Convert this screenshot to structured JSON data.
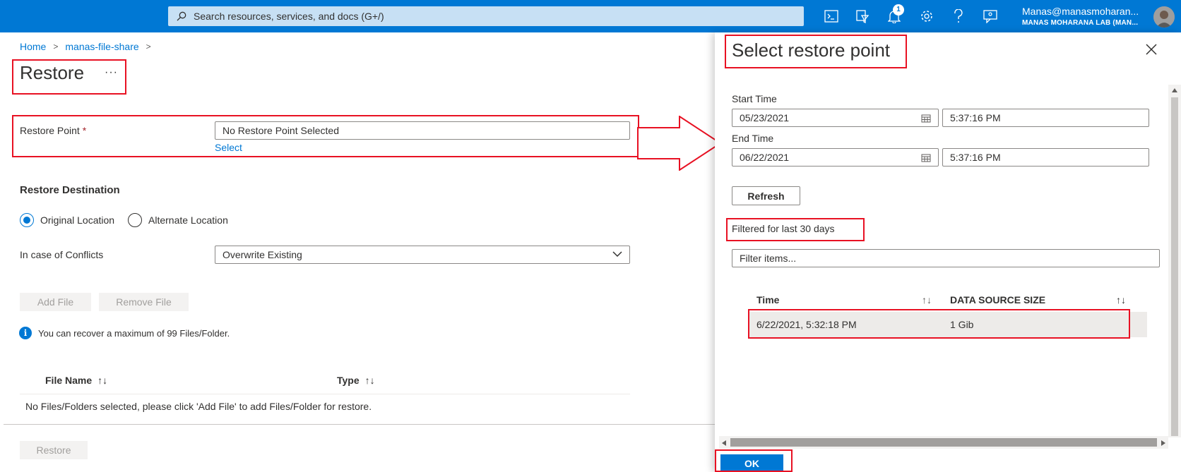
{
  "topbar": {
    "search_placeholder": "Search resources, services, and docs (G+/)",
    "notifications_count": "1",
    "user": "Manas@manasmoharan...",
    "tenant": "MANAS MOHARANA LAB (MAN..."
  },
  "breadcrumb": {
    "home": "Home",
    "resource": "manas-file-share",
    "sep": ">"
  },
  "page": {
    "title": "Restore",
    "more": "···"
  },
  "restore_point": {
    "label": "Restore Point",
    "required": "*",
    "value": "No Restore Point Selected",
    "select_link": "Select"
  },
  "destination": {
    "heading": "Restore Destination",
    "original": "Original Location",
    "alternate": "Alternate Location",
    "conflicts_label": "In case of Conflicts",
    "conflicts_value": "Overwrite Existing"
  },
  "files": {
    "add_file": "Add File",
    "remove_file": "Remove File",
    "info": "You can recover a maximum of 99 Files/Folder.",
    "col_file_name": "File Name",
    "col_type": "Type",
    "sort_glyph": "↑↓",
    "empty": "No Files/Folders selected, please click 'Add File' to add Files/Folder for restore.",
    "restore_button": "Restore"
  },
  "panel": {
    "title": "Select restore point",
    "start_label": "Start Time",
    "start_date": "05/23/2021",
    "start_time": "5:37:16 PM",
    "end_label": "End Time",
    "end_date": "06/22/2021",
    "end_time": "5:37:16 PM",
    "refresh": "Refresh",
    "filtered": "Filtered for last 30 days",
    "filter_placeholder": "Filter items...",
    "col_time": "Time",
    "col_size": "DATA SOURCE SIZE",
    "sort_glyph": "↑↓",
    "rows": [
      {
        "time": "6/22/2021, 5:32:18 PM",
        "size": "1  Gib"
      }
    ],
    "ok": "OK"
  },
  "colors": {
    "accent": "#0078d4",
    "annotation": "#e81123"
  }
}
